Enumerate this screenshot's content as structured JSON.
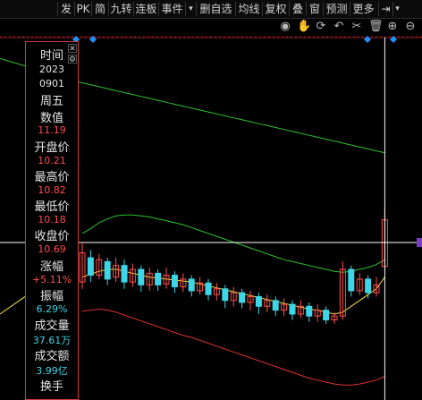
{
  "toolbar": {
    "items": [
      "发",
      "PK",
      "简",
      "九转",
      "连板",
      "事件",
      "▾",
      "删自选",
      "均线",
      "复权",
      "叠",
      "窗",
      "预测",
      "更多"
    ],
    "dock_icon": "dock-right-icon",
    "more_icon": "chevron-down-icon"
  },
  "chart_tools": [
    "eye-icon",
    "hand-icon",
    "refresh-icon",
    "undo-icon",
    "scissors-icon",
    "trash-icon",
    "zoom-in-icon",
    "zoom-out-icon"
  ],
  "info_panel": {
    "time_label": "时间",
    "year": "2023",
    "date": "0901",
    "weekday": "周五",
    "value_label": "数值",
    "value": "11.19",
    "open_label": "开盘价",
    "open": "10.21",
    "high_label": "最高价",
    "high": "10.82",
    "low_label": "最低价",
    "low": "10.18",
    "close_label": "收盘价",
    "close": "10.69",
    "change_label": "涨幅",
    "change": "+5.11%",
    "amplitude_label": "振幅",
    "amplitude": "6.29%",
    "volume_label": "成交量",
    "volume": "37.61万",
    "turnover_label": "成交额",
    "turnover": "3.99亿",
    "turnover_rate_label": "换手"
  },
  "colors": {
    "up": "#ff4d4d",
    "down": "#3dd6e8",
    "ma_short": "#f0e040",
    "band_upper": "#30c030",
    "band_mid": "#30c030",
    "band_lower": "#e03030",
    "crosshair": "#ffffff",
    "marker": "#1e90ff"
  },
  "candles": [
    {
      "o": 10.05,
      "c": 10.35,
      "h": 10.45,
      "l": 9.98
    },
    {
      "o": 10.3,
      "c": 10.12,
      "h": 10.38,
      "l": 10.05
    },
    {
      "o": 10.12,
      "c": 10.28,
      "h": 10.34,
      "l": 10.08
    },
    {
      "o": 10.26,
      "c": 10.08,
      "h": 10.3,
      "l": 10.02
    },
    {
      "o": 10.1,
      "c": 10.22,
      "h": 10.3,
      "l": 10.05
    },
    {
      "o": 10.22,
      "c": 10.05,
      "h": 10.28,
      "l": 9.98
    },
    {
      "o": 10.05,
      "c": 10.18,
      "h": 10.24,
      "l": 10.0
    },
    {
      "o": 10.18,
      "c": 10.02,
      "h": 10.22,
      "l": 9.95
    },
    {
      "o": 10.02,
      "c": 10.14,
      "h": 10.2,
      "l": 9.96
    },
    {
      "o": 10.14,
      "c": 10.02,
      "h": 10.18,
      "l": 9.96
    },
    {
      "o": 10.03,
      "c": 10.12,
      "h": 10.2,
      "l": 9.98
    },
    {
      "o": 10.12,
      "c": 10.0,
      "h": 10.16,
      "l": 9.94
    },
    {
      "o": 10.0,
      "c": 10.08,
      "h": 10.14,
      "l": 9.95
    },
    {
      "o": 10.08,
      "c": 9.96,
      "h": 10.12,
      "l": 9.9
    },
    {
      "o": 9.96,
      "c": 10.04,
      "h": 10.1,
      "l": 9.92
    },
    {
      "o": 10.04,
      "c": 9.92,
      "h": 10.08,
      "l": 9.86
    },
    {
      "o": 9.92,
      "c": 9.98,
      "h": 10.04,
      "l": 9.86
    },
    {
      "o": 9.98,
      "c": 9.86,
      "h": 10.02,
      "l": 9.78
    },
    {
      "o": 9.86,
      "c": 9.94,
      "h": 10.0,
      "l": 9.8
    },
    {
      "o": 9.94,
      "c": 9.84,
      "h": 9.98,
      "l": 9.78
    },
    {
      "o": 9.84,
      "c": 9.9,
      "h": 9.96,
      "l": 9.76
    },
    {
      "o": 9.9,
      "c": 9.8,
      "h": 9.94,
      "l": 9.72
    },
    {
      "o": 9.8,
      "c": 9.86,
      "h": 9.92,
      "l": 9.74
    },
    {
      "o": 9.86,
      "c": 9.76,
      "h": 9.9,
      "l": 9.7
    },
    {
      "o": 9.76,
      "c": 9.82,
      "h": 9.88,
      "l": 9.7
    },
    {
      "o": 9.82,
      "c": 9.72,
      "h": 9.86,
      "l": 9.66
    },
    {
      "o": 9.72,
      "c": 9.8,
      "h": 9.86,
      "l": 9.68
    },
    {
      "o": 9.8,
      "c": 9.7,
      "h": 9.84,
      "l": 9.64
    },
    {
      "o": 9.7,
      "c": 9.76,
      "h": 9.82,
      "l": 9.64
    },
    {
      "o": 9.76,
      "c": 9.66,
      "h": 9.8,
      "l": 9.62
    },
    {
      "o": 9.66,
      "c": 9.7,
      "h": 9.74,
      "l": 9.62
    },
    {
      "o": 9.7,
      "c": 10.18,
      "h": 10.26,
      "l": 9.66
    },
    {
      "o": 10.18,
      "c": 9.96,
      "h": 10.22,
      "l": 9.9
    },
    {
      "o": 9.96,
      "c": 10.08,
      "h": 10.14,
      "l": 9.92
    },
    {
      "o": 10.08,
      "c": 9.94,
      "h": 10.12,
      "l": 9.88
    },
    {
      "o": 9.94,
      "c": 10.02,
      "h": 10.1,
      "l": 9.9
    },
    {
      "o": 10.21,
      "c": 10.69,
      "h": 10.82,
      "l": 10.18
    }
  ],
  "ma_short": [
    10.1,
    10.13,
    10.16,
    10.18,
    10.18,
    10.16,
    10.14,
    10.12,
    10.1,
    10.09,
    10.08,
    10.07,
    10.06,
    10.05,
    10.03,
    10.01,
    9.99,
    9.97,
    9.95,
    9.93,
    9.91,
    9.89,
    9.87,
    9.85,
    9.83,
    9.81,
    9.79,
    9.77,
    9.76,
    9.74,
    9.72,
    9.74,
    9.8,
    9.86,
    9.92,
    9.98,
    10.1
  ],
  "band_upper": [
    10.55,
    10.6,
    10.66,
    10.7,
    10.73,
    10.74,
    10.74,
    10.73,
    10.72,
    10.7,
    10.68,
    10.66,
    10.64,
    10.61,
    10.58,
    10.55,
    10.52,
    10.49,
    10.46,
    10.43,
    10.4,
    10.37,
    10.34,
    10.31,
    10.28,
    10.26,
    10.24,
    10.22,
    10.2,
    10.18,
    10.16,
    10.15,
    10.16,
    10.18,
    10.2,
    10.23,
    10.28
  ],
  "band_lower": [
    9.75,
    9.76,
    9.77,
    9.76,
    9.74,
    9.71,
    9.68,
    9.65,
    9.62,
    9.59,
    9.56,
    9.53,
    9.5,
    9.48,
    9.45,
    9.42,
    9.39,
    9.36,
    9.33,
    9.3,
    9.27,
    9.24,
    9.21,
    9.18,
    9.15,
    9.12,
    9.09,
    9.06,
    9.04,
    9.02,
    9.0,
    8.99,
    8.99,
    9.0,
    9.02,
    9.04,
    9.08
  ],
  "long_ma": [
    12.1,
    12.08,
    12.06,
    12.04,
    12.02,
    12.0,
    11.98,
    11.96,
    11.94,
    11.92,
    11.9,
    11.88,
    11.86,
    11.84,
    11.82,
    11.8,
    11.78,
    11.76,
    11.74,
    11.72,
    11.7,
    11.68,
    11.66,
    11.64,
    11.62,
    11.6,
    11.58,
    11.56,
    11.54,
    11.52,
    11.5,
    11.48,
    11.46,
    11.44,
    11.42,
    11.4,
    11.38
  ]
}
